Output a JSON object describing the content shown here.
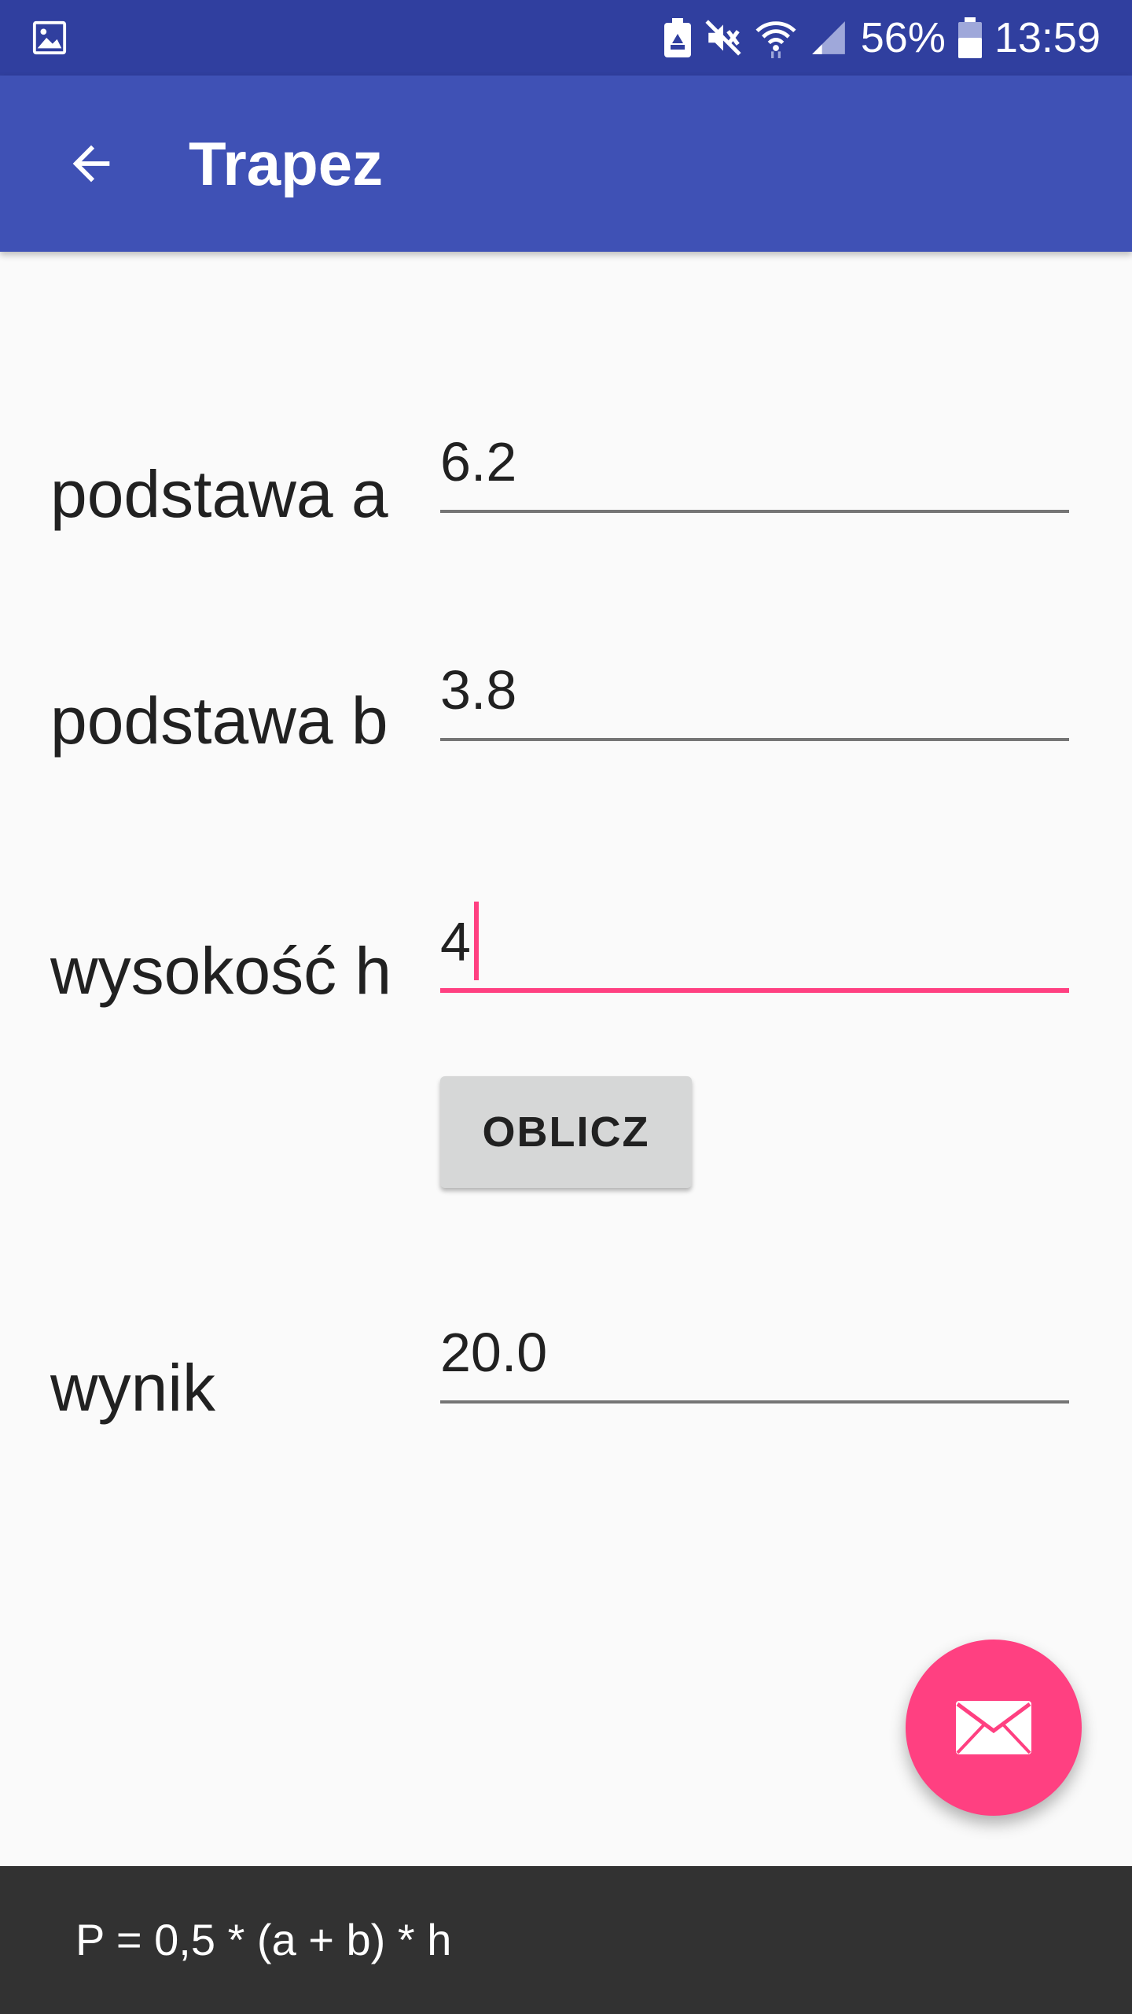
{
  "status_bar": {
    "battery_percent": "56%",
    "time": "13:59",
    "icons": [
      "gallery-icon",
      "battery-saver-icon",
      "mute-icon",
      "wifi-icon",
      "signal-icon",
      "battery-icon"
    ]
  },
  "app_bar": {
    "title": "Trapez",
    "back_icon": "arrow-back-icon"
  },
  "form": {
    "base_a": {
      "label": "podstawa a",
      "value": "6.2"
    },
    "base_b": {
      "label": "podstawa b",
      "value": "3.8"
    },
    "height_h": {
      "label": "wysokość h",
      "value": "4"
    },
    "calculate_label": "OBLICZ",
    "result": {
      "label": "wynik",
      "value": "20.0"
    }
  },
  "fab": {
    "icon": "mail-icon"
  },
  "snackbar": {
    "text": "P = 0,5 * (a + b) * h"
  },
  "colors": {
    "status_bar": "#303f9f",
    "primary": "#3f51b5",
    "accent": "#ff4081",
    "background": "#fafafa",
    "snackbar": "#323232"
  }
}
